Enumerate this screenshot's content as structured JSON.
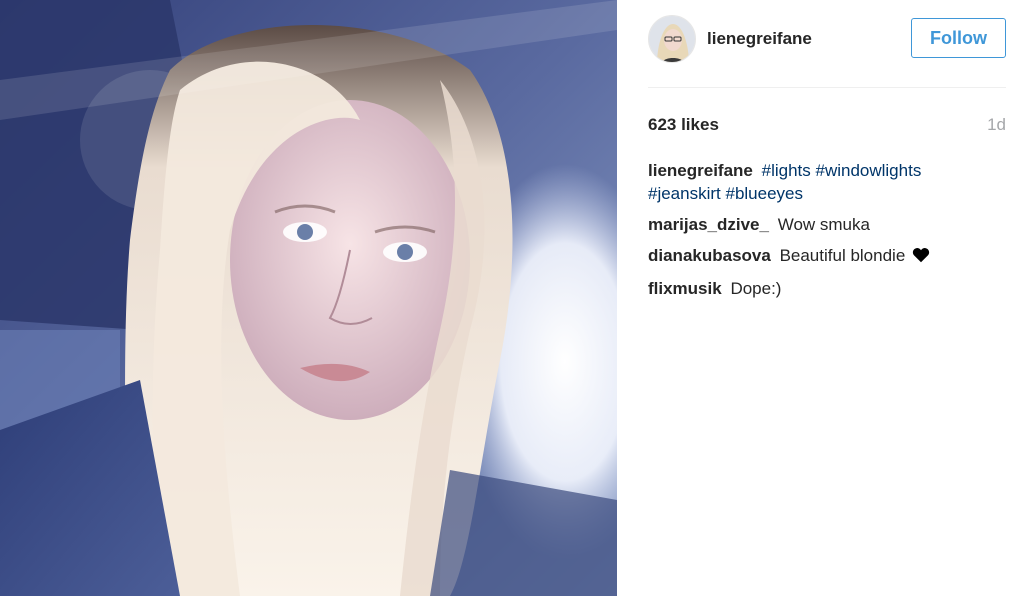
{
  "post": {
    "photo_alt": "selfie-photo"
  },
  "header": {
    "username": "lienegreifane",
    "follow_label": "Follow"
  },
  "stats": {
    "likes": "623 likes",
    "time": "1d"
  },
  "caption": {
    "author": "lienegreifane",
    "hashtags": [
      "#lights",
      "#windowlights",
      "#jeanskirt",
      "#blueeyes"
    ]
  },
  "comments": [
    {
      "author": "marijas_dzive_",
      "text": "Wow smuka"
    },
    {
      "author": "dianakubasova",
      "text": "Beautiful blondie",
      "icon": "black-heart-icon"
    },
    {
      "author": "flixmusik",
      "text": "Dope:)"
    }
  ],
  "colors": {
    "link": "#003569",
    "follow": "#3f97d8",
    "muted": "#a5a7aa"
  }
}
